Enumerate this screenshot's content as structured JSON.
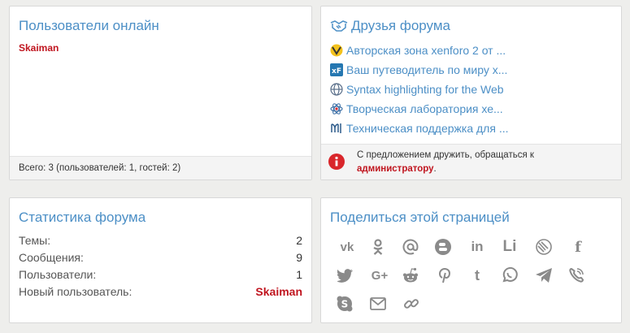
{
  "online": {
    "title": "Пользователи онлайн",
    "user": "Skaiman",
    "footer": "Всего: 3 (пользователей: 1, гостей: 2)"
  },
  "friends": {
    "title": "Друзья форума",
    "items": [
      {
        "label": "Авторская зона xenforo 2 от ...",
        "icon": "xenforo-zone-icon"
      },
      {
        "label": "Ваш путеводитель по миру х...",
        "icon": "xf-guide-icon"
      },
      {
        "label": "Syntax highlighting for the Web",
        "icon": "globe-icon"
      },
      {
        "label": "Творческая лаборатория хе...",
        "icon": "lab-icon"
      },
      {
        "label": "Техническая поддержка для ...",
        "icon": "support-icon"
      }
    ],
    "footer_text": "С предложением дружить, обращаться к",
    "footer_link": "администратору",
    "footer_end": "."
  },
  "stats": {
    "title": "Статистика форума",
    "rows": [
      {
        "label": "Темы:",
        "value": "2"
      },
      {
        "label": "Сообщения:",
        "value": "9"
      },
      {
        "label": "Пользователи:",
        "value": "1"
      },
      {
        "label": "Новый пользователь:",
        "value": "Skaiman"
      }
    ]
  },
  "share": {
    "title": "Поделиться этой страницей",
    "icons": [
      "vk-icon",
      "odnoklassniki-icon",
      "email-at-icon",
      "blogger-icon",
      "linkedin-icon",
      "livejournal-icon",
      "liveinternet-icon",
      "facebook-icon",
      "twitter-icon",
      "google-plus-icon",
      "reddit-icon",
      "pinterest-icon",
      "tumblr-icon",
      "whatsapp-icon",
      "telegram-icon",
      "viber-icon",
      "skype-icon",
      "email-icon",
      "link-icon"
    ],
    "labels": {
      "vk": "vk",
      "linkedin": "in",
      "livejournal": "Li",
      "facebook": "f",
      "google_plus": "G+",
      "tumblr": "t"
    }
  },
  "colors": {
    "accent": "#4c8fc6",
    "username": "#c0151f",
    "icon": "#8a8a8a",
    "info": "#d9262b"
  }
}
